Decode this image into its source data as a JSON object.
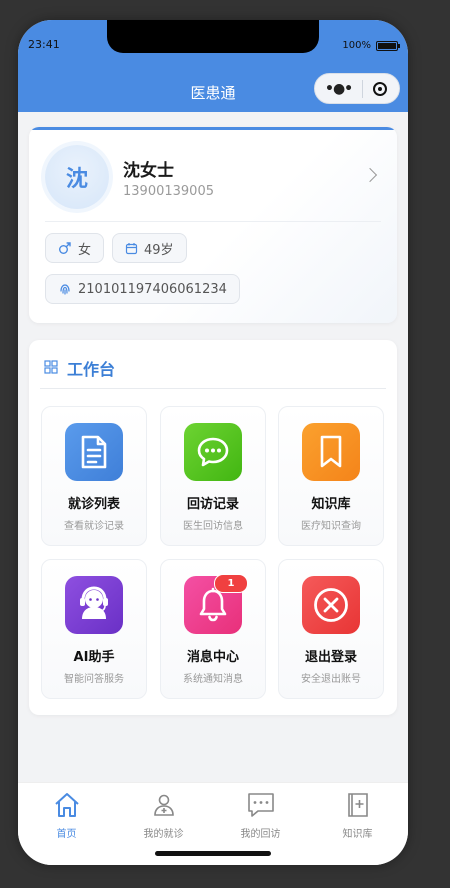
{
  "status": {
    "time": "23:41",
    "battery": "100%"
  },
  "nav": {
    "title": "医患通"
  },
  "profile": {
    "avatar_char": "沈",
    "name": "沈女士",
    "phone": "13900139005",
    "gender": "女",
    "age": "49岁",
    "id_number": "210101197406061234"
  },
  "workbench": {
    "title": "工作台",
    "tiles": [
      {
        "label": "就诊列表",
        "sub": "查看就诊记录",
        "icon": "document-icon",
        "color": "#4a8be2"
      },
      {
        "label": "回访记录",
        "sub": "医生回访信息",
        "icon": "chat-icon",
        "color": "#4cc11a"
      },
      {
        "label": "知识库",
        "sub": "医疗知识查询",
        "icon": "bookmark-icon",
        "color": "#f7921e"
      },
      {
        "label": "AI助手",
        "sub": "智能问答服务",
        "icon": "assistant-icon",
        "color": "#7b3fd0"
      },
      {
        "label": "消息中心",
        "sub": "系统通知消息",
        "icon": "bell-icon",
        "color": "#ee3d8f",
        "badge": "1"
      },
      {
        "label": "退出登录",
        "sub": "安全退出账号",
        "icon": "close-circle-icon",
        "color": "#f04545"
      }
    ]
  },
  "tabbar": {
    "items": [
      {
        "label": "首页",
        "icon": "home-icon",
        "active": true
      },
      {
        "label": "我的就诊",
        "icon": "doctor-icon",
        "active": false
      },
      {
        "label": "我的回访",
        "icon": "message-icon",
        "active": false
      },
      {
        "label": "知识库",
        "icon": "book-plus-icon",
        "active": false
      }
    ]
  },
  "colors": {
    "primary": "#4a8be2",
    "badge": "#f04040"
  }
}
